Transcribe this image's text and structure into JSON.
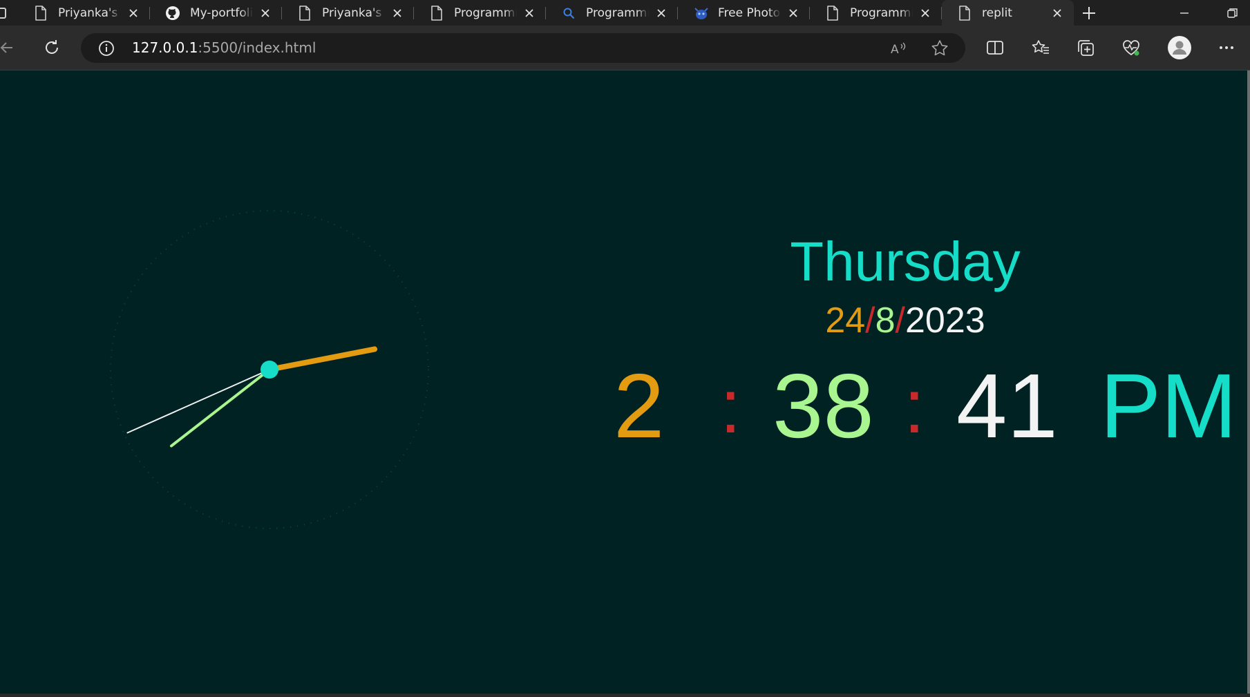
{
  "browser": {
    "tabs": [
      {
        "title": "Priyanka's p",
        "icon": "page-icon",
        "active": false
      },
      {
        "title": "My-portfolio",
        "icon": "github-icon",
        "active": false
      },
      {
        "title": "Priyanka's p",
        "icon": "page-icon",
        "active": false
      },
      {
        "title": "Programmin",
        "icon": "page-icon",
        "active": false
      },
      {
        "title": "Programmin",
        "icon": "search-icon",
        "active": false
      },
      {
        "title": "Free Photo",
        "icon": "creature-icon",
        "active": false
      },
      {
        "title": "Programmin",
        "icon": "page-icon",
        "active": false
      },
      {
        "title": "replit",
        "icon": "page-icon",
        "active": true
      }
    ],
    "address": {
      "host": "127.0.0.1",
      "rest": ":5500/index.html"
    }
  },
  "page": {
    "day_name": "Thursday",
    "date": {
      "day": "24",
      "separator": "/",
      "month": "8",
      "year": "2023"
    },
    "time": {
      "hour": "2",
      "separator": ":",
      "minute": "38",
      "second": "41",
      "ampm": "PM"
    }
  },
  "analog_clock": {
    "hour": 2,
    "minute": 38,
    "second": 41,
    "hand_colors": {
      "hour": "#e39b12",
      "minute": "#a9f58f",
      "second": "#f0f0f0",
      "center": "#16ddc8"
    }
  },
  "colors": {
    "background": "#012223",
    "teal": "#16ddc8",
    "orange": "#e39b12",
    "green": "#a9f58f",
    "red": "#c8292a",
    "white": "#f3f3f3"
  }
}
